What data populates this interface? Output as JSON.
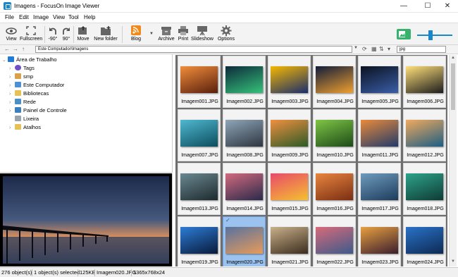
{
  "window": {
    "title": "Imagens - FocusOn Image Viewer",
    "minimize": "—",
    "maximize": "☐",
    "close": "✕"
  },
  "menu": [
    "File",
    "Edit",
    "Image",
    "View",
    "Tool",
    "Help"
  ],
  "toolbar": {
    "view": "View",
    "fullscreen": "Fullscreen",
    "rotate_left": "-90°",
    "rotate_right": "90°",
    "move": "Move",
    "new_folder": "New folder",
    "blog": "Blog",
    "archive": "Archive",
    "print": "Print",
    "slideshow": "Slideshow",
    "options": "Options"
  },
  "address": {
    "path": "Este Computador\\Imagens",
    "search": "jpg",
    "back": "←",
    "forward": "→",
    "up": "↑"
  },
  "tree": [
    {
      "label": "Área de Trabalho",
      "color": "#1f7bd6"
    },
    {
      "label": "Tags",
      "color": "#6d4fc9"
    },
    {
      "label": "smp",
      "color": "#d9a14a"
    },
    {
      "label": "Este Computador",
      "color": "#4f8fd6"
    },
    {
      "label": "Bibliotecas",
      "color": "#e8c156"
    },
    {
      "label": "Rede",
      "color": "#4a90c8"
    },
    {
      "label": "Painel de Controle",
      "color": "#3c7fc0"
    },
    {
      "label": "Lixeira",
      "color": "#9aa4ad"
    },
    {
      "label": "Atalhos",
      "color": "#e8c156"
    }
  ],
  "images": [
    {
      "name": "Imagem001.JPG",
      "c1": "#f08d3b",
      "c2": "#5a1f0c"
    },
    {
      "name": "Imagem002.JPG",
      "c1": "#0d2a3a",
      "c2": "#35c27a"
    },
    {
      "name": "Imagem003.JPG",
      "c1": "#f5b800",
      "c2": "#1a2d6b"
    },
    {
      "name": "Imagem004.JPG",
      "c1": "#101c3a",
      "c2": "#f0a030"
    },
    {
      "name": "Imagem005.JPG",
      "c1": "#0b1220",
      "c2": "#3a5ea8"
    },
    {
      "name": "Imagem006.JPG",
      "c1": "#ffe07a",
      "c2": "#1c1c1c"
    },
    {
      "name": "Imagem007.JPG",
      "c1": "#4fb8d0",
      "c2": "#0c4d5e"
    },
    {
      "name": "Imagem008.JPG",
      "c1": "#8ea6b8",
      "c2": "#2e3540"
    },
    {
      "name": "Imagem009.JPG",
      "c1": "#f09040",
      "c2": "#2c5a26"
    },
    {
      "name": "Imagem010.JPG",
      "c1": "#7fc545",
      "c2": "#1c4a18"
    },
    {
      "name": "Imagem011.JPG",
      "c1": "#e88a3a",
      "c2": "#223a6a"
    },
    {
      "name": "Imagem012.JPG",
      "c1": "#f2a95c",
      "c2": "#1b5d84"
    },
    {
      "name": "Imagem013.JPG",
      "c1": "#6a8890",
      "c2": "#1e2a2e"
    },
    {
      "name": "Imagem014.JPG",
      "c1": "#d26a7e",
      "c2": "#2a2a4a"
    },
    {
      "name": "Imagem015.JPG",
      "c1": "#e84a6a",
      "c2": "#f5c030"
    },
    {
      "name": "Imagem016.JPG",
      "c1": "#e88540",
      "c2": "#7a2e12"
    },
    {
      "name": "Imagem017.JPG",
      "c1": "#6f9bbd",
      "c2": "#1d3c5c"
    },
    {
      "name": "Imagem018.JPG",
      "c1": "#2ea38a",
      "c2": "#0e3b34"
    },
    {
      "name": "Imagem019.JPG",
      "c1": "#2d7cd6",
      "c2": "#081a3a"
    },
    {
      "name": "Imagem020.JPG",
      "c1": "#5872a0",
      "c2": "#e89b5a"
    },
    {
      "name": "Imagem021.JPG",
      "c1": "#c9b08a",
      "c2": "#3b2c1d"
    },
    {
      "name": "Imagem022.JPG",
      "c1": "#d86a7a",
      "c2": "#3c5a8a"
    },
    {
      "name": "Imagem023.JPG",
      "c1": "#e8a040",
      "c2": "#3a1e2e"
    },
    {
      "name": "Imagem024.JPG",
      "c1": "#2a72c9",
      "c2": "#0d2a52"
    }
  ],
  "selected_index": 19,
  "status": {
    "count": "276 object(s)",
    "selected": "1 object(s) selected",
    "size": "125KB",
    "file": "Imagem020.JPG",
    "dims": "1365x768x24"
  },
  "colors": {
    "accent": "#1b87c9",
    "selection": "#9cc3ef",
    "grid_bg": "#6e6e6e"
  }
}
